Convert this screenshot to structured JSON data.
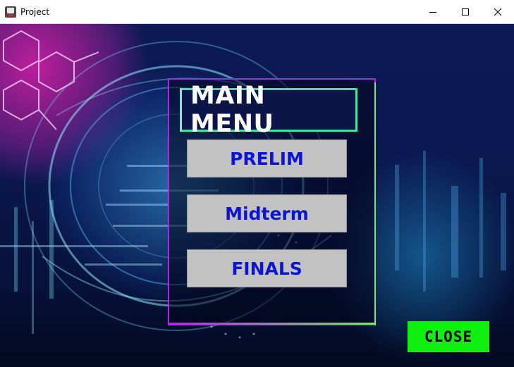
{
  "window": {
    "title": "Project",
    "icon": "java-app-icon",
    "controls": [
      "minimize-icon",
      "maximize-icon",
      "close-icon"
    ]
  },
  "background": {
    "description_icon": "digital-globe-background"
  },
  "menu": {
    "title": "MAIN MENU",
    "buttons": {
      "prelim": "PRELIM",
      "midterm": "Midterm",
      "finals": "FINALS"
    }
  },
  "footer": {
    "close_label": "CLOSE"
  },
  "colors": {
    "panel_border": "#b324e6",
    "title_border": "#3fe3a4",
    "button_bg": "#c2c2c2",
    "button_text": "#0c14d8",
    "close_bg": "#10f010"
  }
}
